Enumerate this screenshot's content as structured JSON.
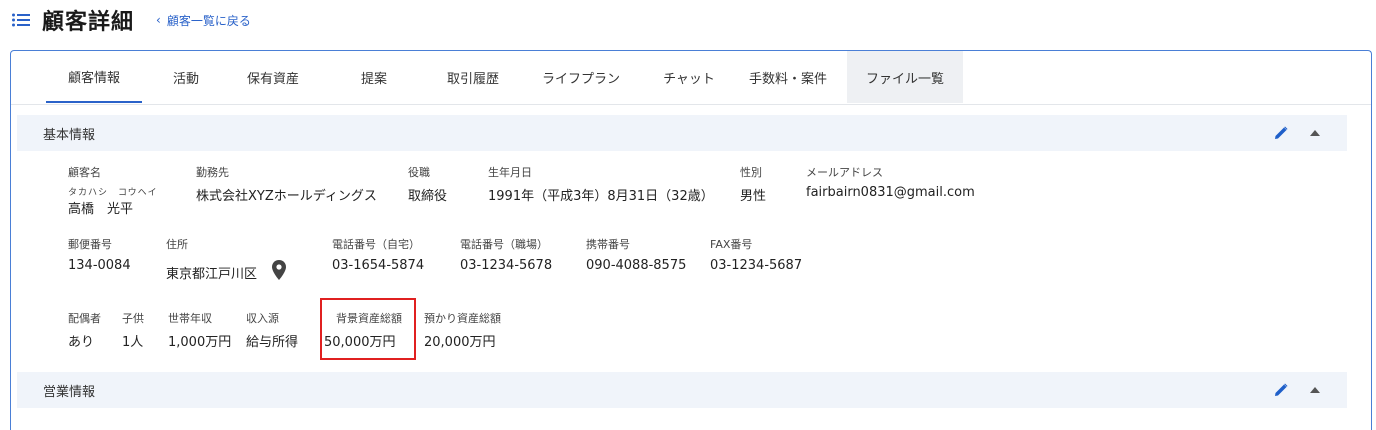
{
  "header": {
    "title": "顧客詳細",
    "back_label": "顧客一覧に戻る"
  },
  "tabs": [
    {
      "label": "顧客情報"
    },
    {
      "label": "活動"
    },
    {
      "label": "保有資産"
    },
    {
      "label": "提案"
    },
    {
      "label": "取引履歴"
    },
    {
      "label": "ライフプラン"
    },
    {
      "label": "チャット"
    },
    {
      "label": "手数料・案件"
    },
    {
      "label": "ファイル一覧"
    }
  ],
  "basic": {
    "title": "基本情報",
    "name_label": "顧客名",
    "name_kana": "タカハシ　コウヘイ",
    "name": "高橋　光平",
    "employer_label": "勤務先",
    "employer": "株式会社XYZホールディングス",
    "position_label": "役職",
    "position": "取締役",
    "birth_label": "生年月日",
    "birth": "1991年（平成3年）8月31日（32歳）",
    "gender_label": "性別",
    "gender": "男性",
    "email_label": "メールアドレス",
    "email": "fairbairn0831@gmail.com",
    "zip_label": "郵便番号",
    "zip": "134-0084",
    "address_label": "住所",
    "address": "東京都江戸川区",
    "phone_home_label": "電話番号（自宅）",
    "phone_home": "03-1654-5874",
    "phone_work_label": "電話番号（職場）",
    "phone_work": "03-1234-5678",
    "mobile_label": "携帯番号",
    "mobile": "090-4088-8575",
    "fax_label": "FAX番号",
    "fax": "03-1234-5687",
    "spouse_label": "配偶者",
    "spouse": "あり",
    "children_label": "子供",
    "children": "1人",
    "income_label": "世帯年収",
    "income": "1,000万円",
    "income_source_label": "収入源",
    "income_source": "給与所得",
    "background_assets_label": "背景資産総額",
    "background_assets": "50,000万円",
    "deposit_assets_label": "預かり資産総額",
    "deposit_assets": "20,000万円"
  },
  "sales": {
    "title": "営業情報"
  },
  "icons": {
    "menu": "list-menu-icon",
    "back": "chevron-left-icon",
    "edit": "pencil-icon",
    "collapse": "triangle-up-icon",
    "location": "map-pin-icon"
  },
  "colors": {
    "accent": "#2a62c9",
    "card_border": "#4a7fd6",
    "section_bg": "#f0f4fa",
    "highlight": "#e02020"
  }
}
